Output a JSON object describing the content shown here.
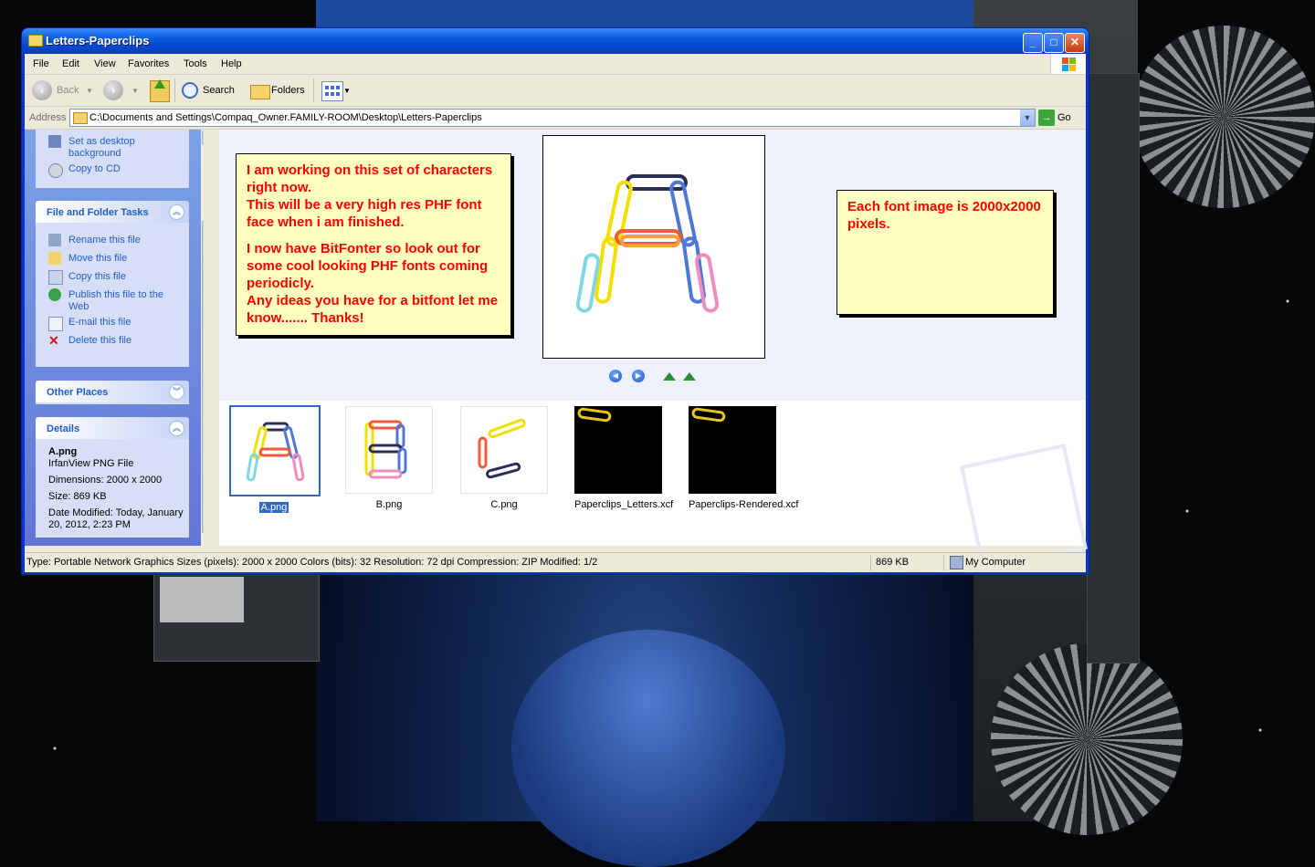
{
  "window": {
    "title": "Letters-Paperclips"
  },
  "menu": [
    "File",
    "Edit",
    "View",
    "Favorites",
    "Tools",
    "Help"
  ],
  "toolbar": {
    "back_label": "Back",
    "search_label": "Search",
    "folders_label": "Folders"
  },
  "address": {
    "label": "Address",
    "path": "C:\\Documents and Settings\\Compaq_Owner.FAMILY-ROOM\\Desktop\\Letters-Paperclips",
    "go_label": "Go"
  },
  "taskpane": {
    "top_links": [
      "Set as desktop background",
      "Copy to CD"
    ],
    "file_tasks": {
      "title": "File and Folder Tasks",
      "links": [
        "Rename this file",
        "Move this file",
        "Copy this file",
        "Publish this file to the Web",
        "E-mail this file",
        "Delete this file"
      ]
    },
    "other_places": {
      "title": "Other Places"
    },
    "details": {
      "title": "Details",
      "name": "A.png",
      "type": "IrfanView PNG File",
      "dimensions": "Dimensions: 2000 x 2000",
      "size": "Size: 869 KB",
      "date_modified": "Date Modified: Today, January 20, 2012, 2:23 PM"
    }
  },
  "notes": {
    "left_paragraph_1": "I am working on this set of characters right now.\nThis will be a very high res PHF font face when i am finished.",
    "left_paragraph_2": "I now have BitFonter so look out for some cool looking PHF fonts coming periodicly.\nAny ideas you have for a bitfont let me know....... Thanks!",
    "right": "Each font image is 2000x2000 pixels."
  },
  "files": [
    {
      "name": "A.png",
      "selected": true
    },
    {
      "name": "B.png",
      "selected": false
    },
    {
      "name": "C.png",
      "selected": false
    },
    {
      "name": "Paperclips_Letters.xcf",
      "selected": false
    },
    {
      "name": "Paperclips-Rendered.xcf",
      "selected": false
    }
  ],
  "statusbar": {
    "info": "Type: Portable Network Graphics Sizes (pixels): 2000 x 2000 Colors (bits): 32 Resolution: 72 dpi Compression: ZIP Modified: 1/2",
    "size": "869 KB",
    "zone": "My Computer"
  },
  "colors": {
    "link": "#215dc6",
    "note_text": "#ff0000",
    "note_bg": "#ffffc0",
    "selection": "#316ac5",
    "titlebar": "#0a5bde"
  }
}
